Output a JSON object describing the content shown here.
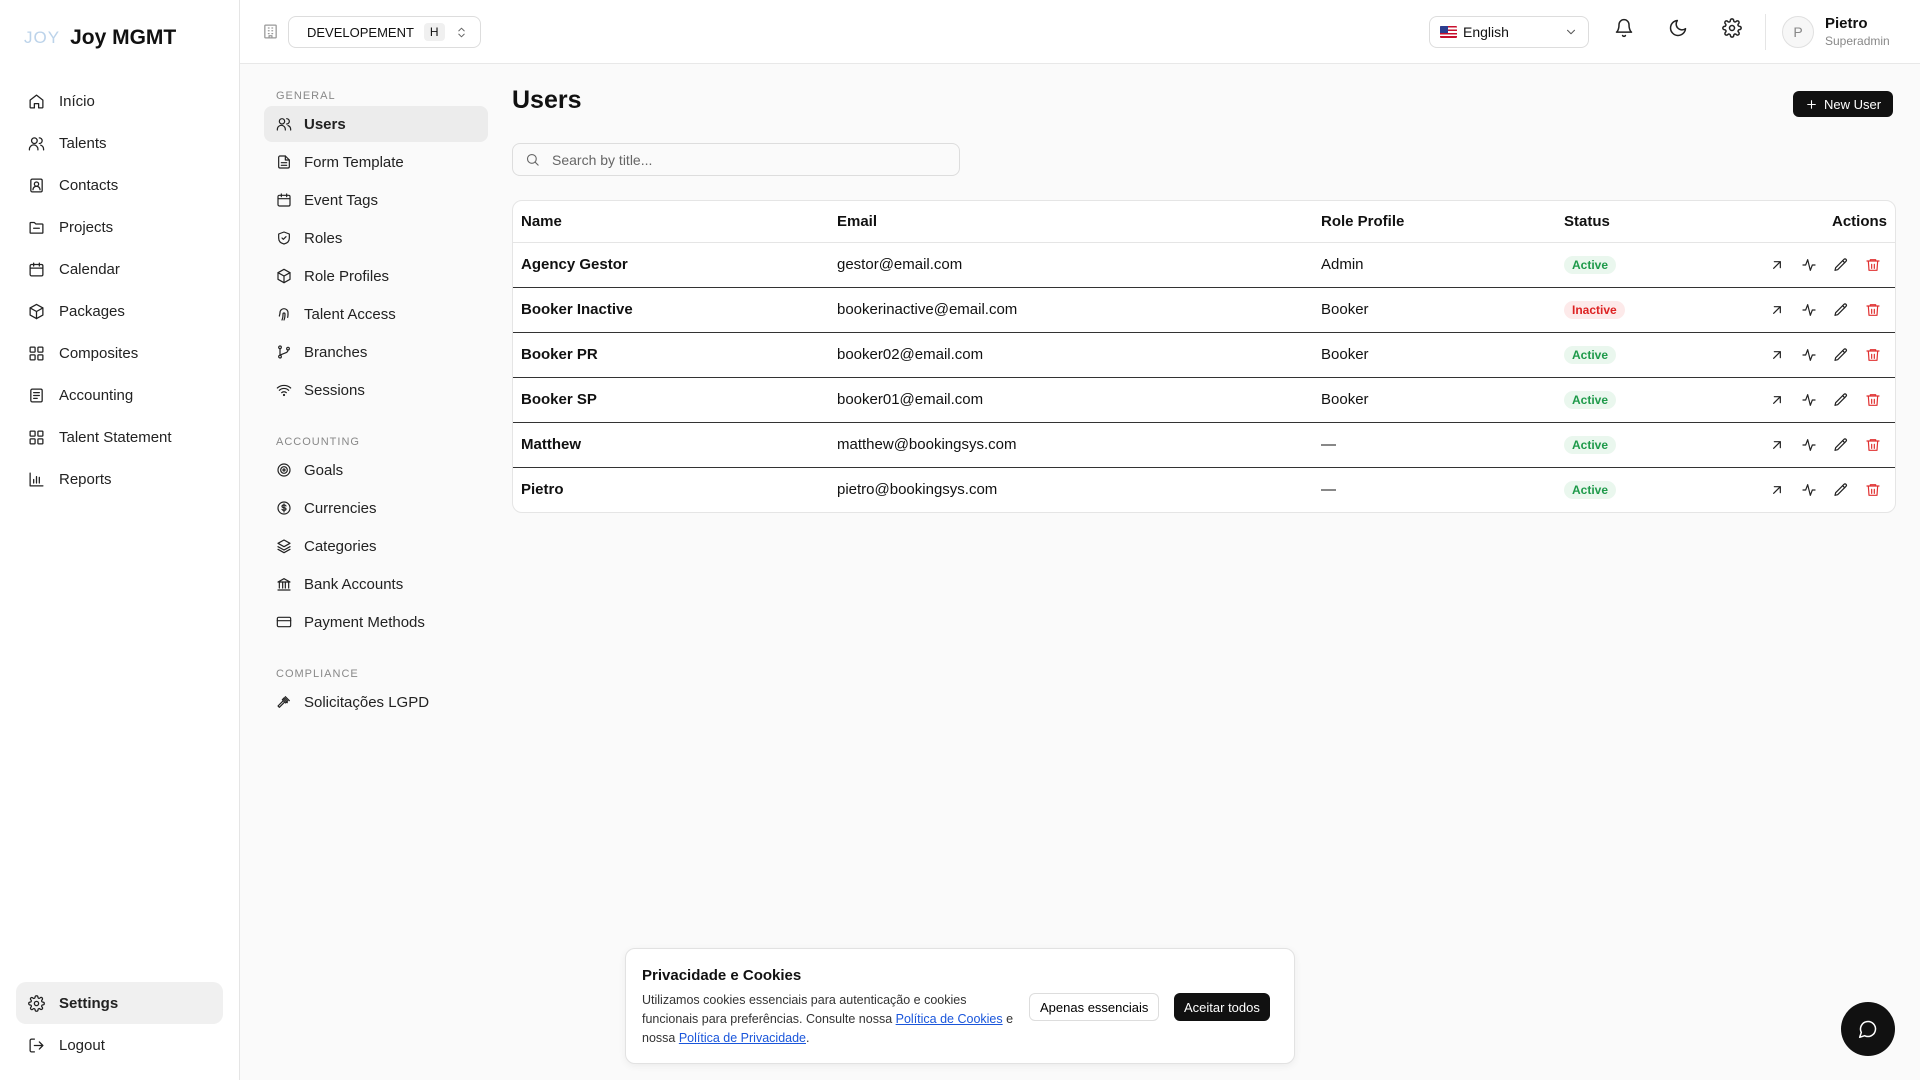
{
  "brand": {
    "mark": "JOY",
    "name": "Joy MGMT"
  },
  "sidebar": {
    "items": [
      {
        "label": "Início",
        "icon": "home-icon"
      },
      {
        "label": "Talents",
        "icon": "users-icon"
      },
      {
        "label": "Contacts",
        "icon": "contact-icon"
      },
      {
        "label": "Projects",
        "icon": "folder-icon"
      },
      {
        "label": "Calendar",
        "icon": "calendar-icon"
      },
      {
        "label": "Packages",
        "icon": "package-icon"
      },
      {
        "label": "Composites",
        "icon": "grid-icon"
      },
      {
        "label": "Accounting",
        "icon": "ledger-icon"
      },
      {
        "label": "Talent Statement",
        "icon": "grid-icon"
      },
      {
        "label": "Reports",
        "icon": "chart-icon"
      }
    ],
    "settings_label": "Settings",
    "logout_label": "Logout"
  },
  "topbar": {
    "environment": "DEVELOPEMENT",
    "environment_badge": "H",
    "language": "English",
    "user": {
      "initial": "P",
      "name": "Pietro",
      "role": "Superadmin"
    }
  },
  "subnav": {
    "general_label": "GENERAL",
    "general": [
      "Users",
      "Form Template",
      "Event Tags",
      "Roles",
      "Role Profiles",
      "Talent Access",
      "Branches",
      "Sessions"
    ],
    "accounting_label": "ACCOUNTING",
    "accounting": [
      "Goals",
      "Currencies",
      "Categories",
      "Bank Accounts",
      "Payment Methods"
    ],
    "compliance_label": "COMPLIANCE",
    "compliance": [
      "Solicitações LGPD"
    ]
  },
  "page": {
    "title": "Users",
    "new_user_label": "New User",
    "search_placeholder": "Search by title..."
  },
  "table": {
    "columns": {
      "name": "Name",
      "email": "Email",
      "role_profile": "Role Profile",
      "status": "Status",
      "actions": "Actions"
    },
    "rows": [
      {
        "name": "Agency Gestor",
        "email": "gestor@email.com",
        "role": "Admin",
        "status": "Active"
      },
      {
        "name": "Booker Inactive",
        "email": "bookerinactive@email.com",
        "role": "Booker",
        "status": "Inactive"
      },
      {
        "name": "Booker PR",
        "email": "booker02@email.com",
        "role": "Booker",
        "status": "Active"
      },
      {
        "name": "Booker SP",
        "email": "booker01@email.com",
        "role": "Booker",
        "status": "Active"
      },
      {
        "name": "Matthew",
        "email": "matthew@bookingsys.com",
        "role": "—",
        "status": "Active"
      },
      {
        "name": "Pietro",
        "email": "pietro@bookingsys.com",
        "role": "—",
        "status": "Active"
      }
    ]
  },
  "cookie": {
    "title": "Privacidade e Cookies",
    "text_1": "Utilizamos cookies essenciais para autenticação e cookies funcionais para preferências. Consulte nossa ",
    "link_cookies": "Política de Cookies",
    "text_2": " e nossa ",
    "link_privacy": "Política de Privacidade",
    "text_3": ".",
    "essential_label": "Apenas essenciais",
    "accept_label": "Aceitar todos"
  },
  "colors": {
    "accent": "#111111",
    "active_green": "#1e9a4a",
    "inactive_red": "#dd2222",
    "delete_red": "#e03131",
    "link_blue": "#1a56db"
  }
}
